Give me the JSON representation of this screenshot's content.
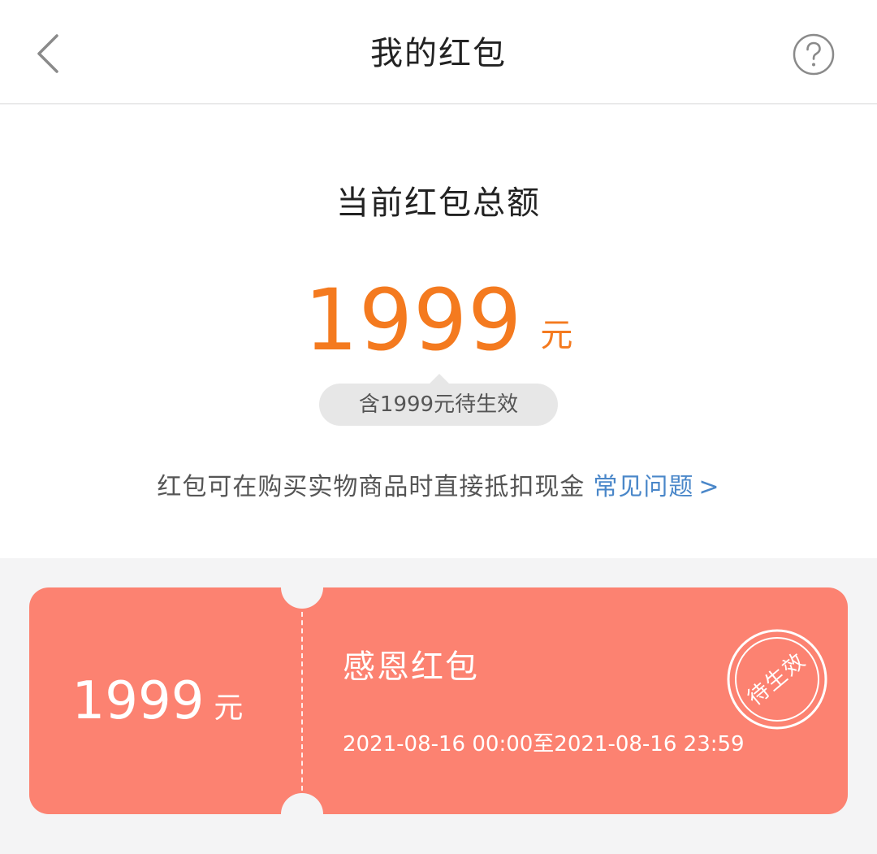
{
  "header": {
    "title": "我的红包",
    "back_icon": "chevron-left-icon",
    "help_icon": "help-circle-icon"
  },
  "summary": {
    "label": "当前红包总额",
    "amount": "1999",
    "unit": "元",
    "pending_note": "含1999元待生效",
    "info_text": "红包可在购买实物商品时直接抵扣现金",
    "faq_link": "常见问题",
    "faq_arrow": ">"
  },
  "coupons": [
    {
      "amount": "1999",
      "unit": "元",
      "name": "感恩红包",
      "validity": "2021-08-16 00:00至2021-08-16 23:59",
      "stamp": "待生效"
    }
  ],
  "colors": {
    "accent_orange": "#f47a1f",
    "coupon_red": "#fc8271",
    "link_blue": "#4a87c9",
    "page_gray": "#f4f4f5"
  }
}
